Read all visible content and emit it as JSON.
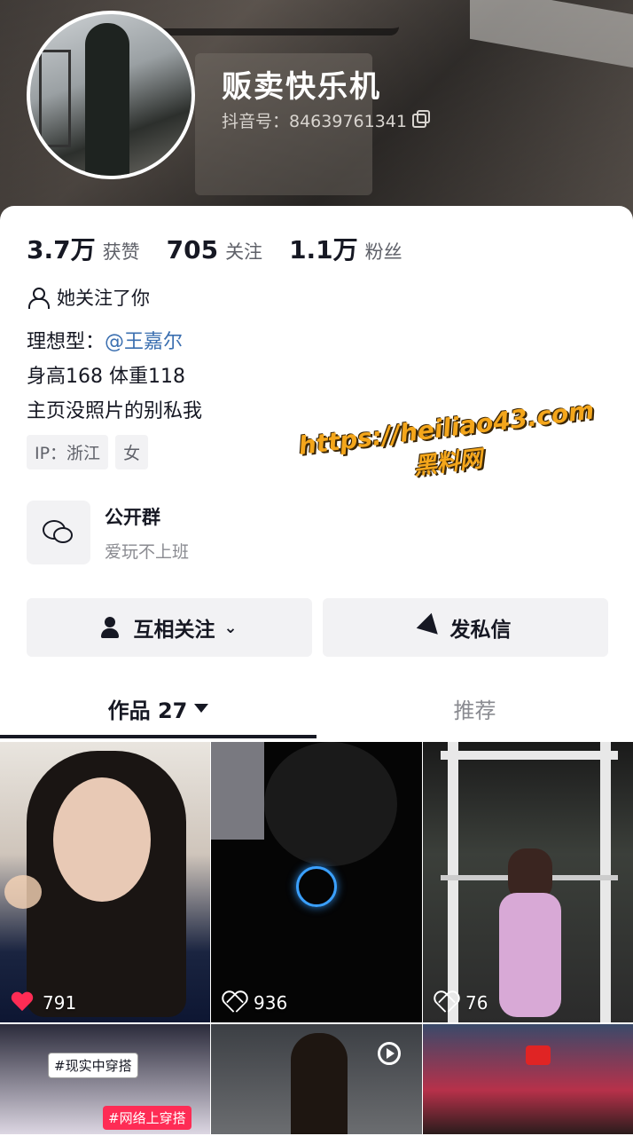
{
  "profile": {
    "nickname": "贩卖快乐机",
    "douyin_id": "抖音号：84639761341"
  },
  "stats": [
    {
      "value": "3.7万",
      "label": "获赞"
    },
    {
      "value": "705",
      "label": "关注"
    },
    {
      "value": "1.1万",
      "label": "粉丝"
    }
  ],
  "follows_you": "她关注了你",
  "bio": {
    "line1_prefix": "理想型：",
    "line1_mention": "@王嘉尔",
    "line2": "身高168 体重118",
    "line3": "主页没照片的别私我"
  },
  "tags": [
    "IP：浙江",
    "女"
  ],
  "group": {
    "name": "公开群",
    "desc": "爱玩不上班"
  },
  "buttons": {
    "follow": "互相关注",
    "message": "发私信"
  },
  "tabs": {
    "works_label": "作品 27",
    "recommend_label": "推荐"
  },
  "videos": [
    {
      "likes": "791",
      "liked": true
    },
    {
      "likes": "936",
      "liked": false
    },
    {
      "likes": "76",
      "liked": false
    }
  ],
  "overlay_tags": [
    "#现实中穿搭",
    "#网络上穿搭"
  ],
  "watermark": {
    "url": "https://heiliao43.com",
    "name": "黑料网"
  },
  "colors": {
    "accent_red": "#fe2c55",
    "mention_blue": "#3b6fb0",
    "watermark": "#f4a61b"
  }
}
